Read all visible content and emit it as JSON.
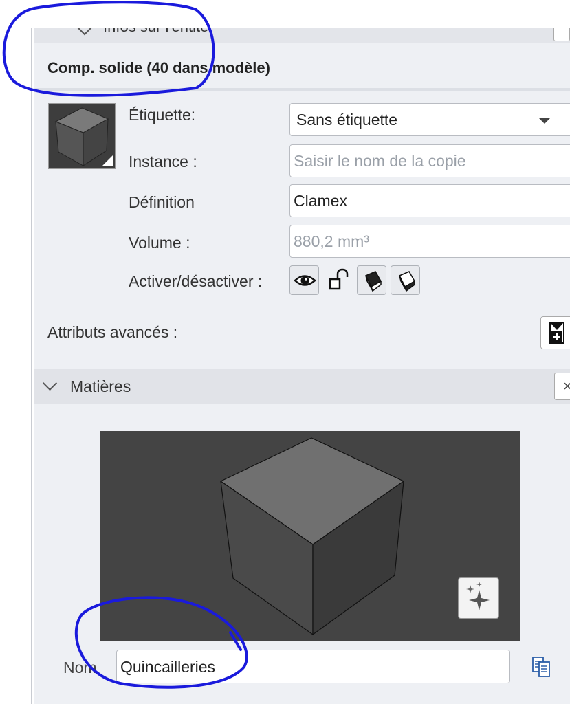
{
  "panels": {
    "entity_info": {
      "title": "Infos sur l'entité"
    },
    "materials": {
      "title": "Matières",
      "close": "×"
    }
  },
  "entity": {
    "heading": "Comp. solide (40 dans modèle)",
    "fields": {
      "tag_label": "Étiquette:",
      "tag_value": "Sans étiquette",
      "instance_label": "Instance :",
      "instance_placeholder": "Saisir le nom de la copie",
      "definition_label": "Définition",
      "definition_value": "Clamex",
      "volume_label": "Volume :",
      "volume_value": "880,2 mm³",
      "toggle_label": "Activer/désactiver :"
    },
    "toggles": [
      "eye-icon",
      "lock-open-icon",
      "receive-shadows-icon",
      "cast-shadows-icon"
    ],
    "advanced_label": "Attributs avancés :"
  },
  "material": {
    "name_label": "Nom",
    "name_value": "Quincailleries",
    "preview_icon": "sparkle-icon"
  },
  "colors": {
    "panel_bg": "#eef0f4",
    "preview_bg": "#444444",
    "annotation": "#1a1adc"
  }
}
